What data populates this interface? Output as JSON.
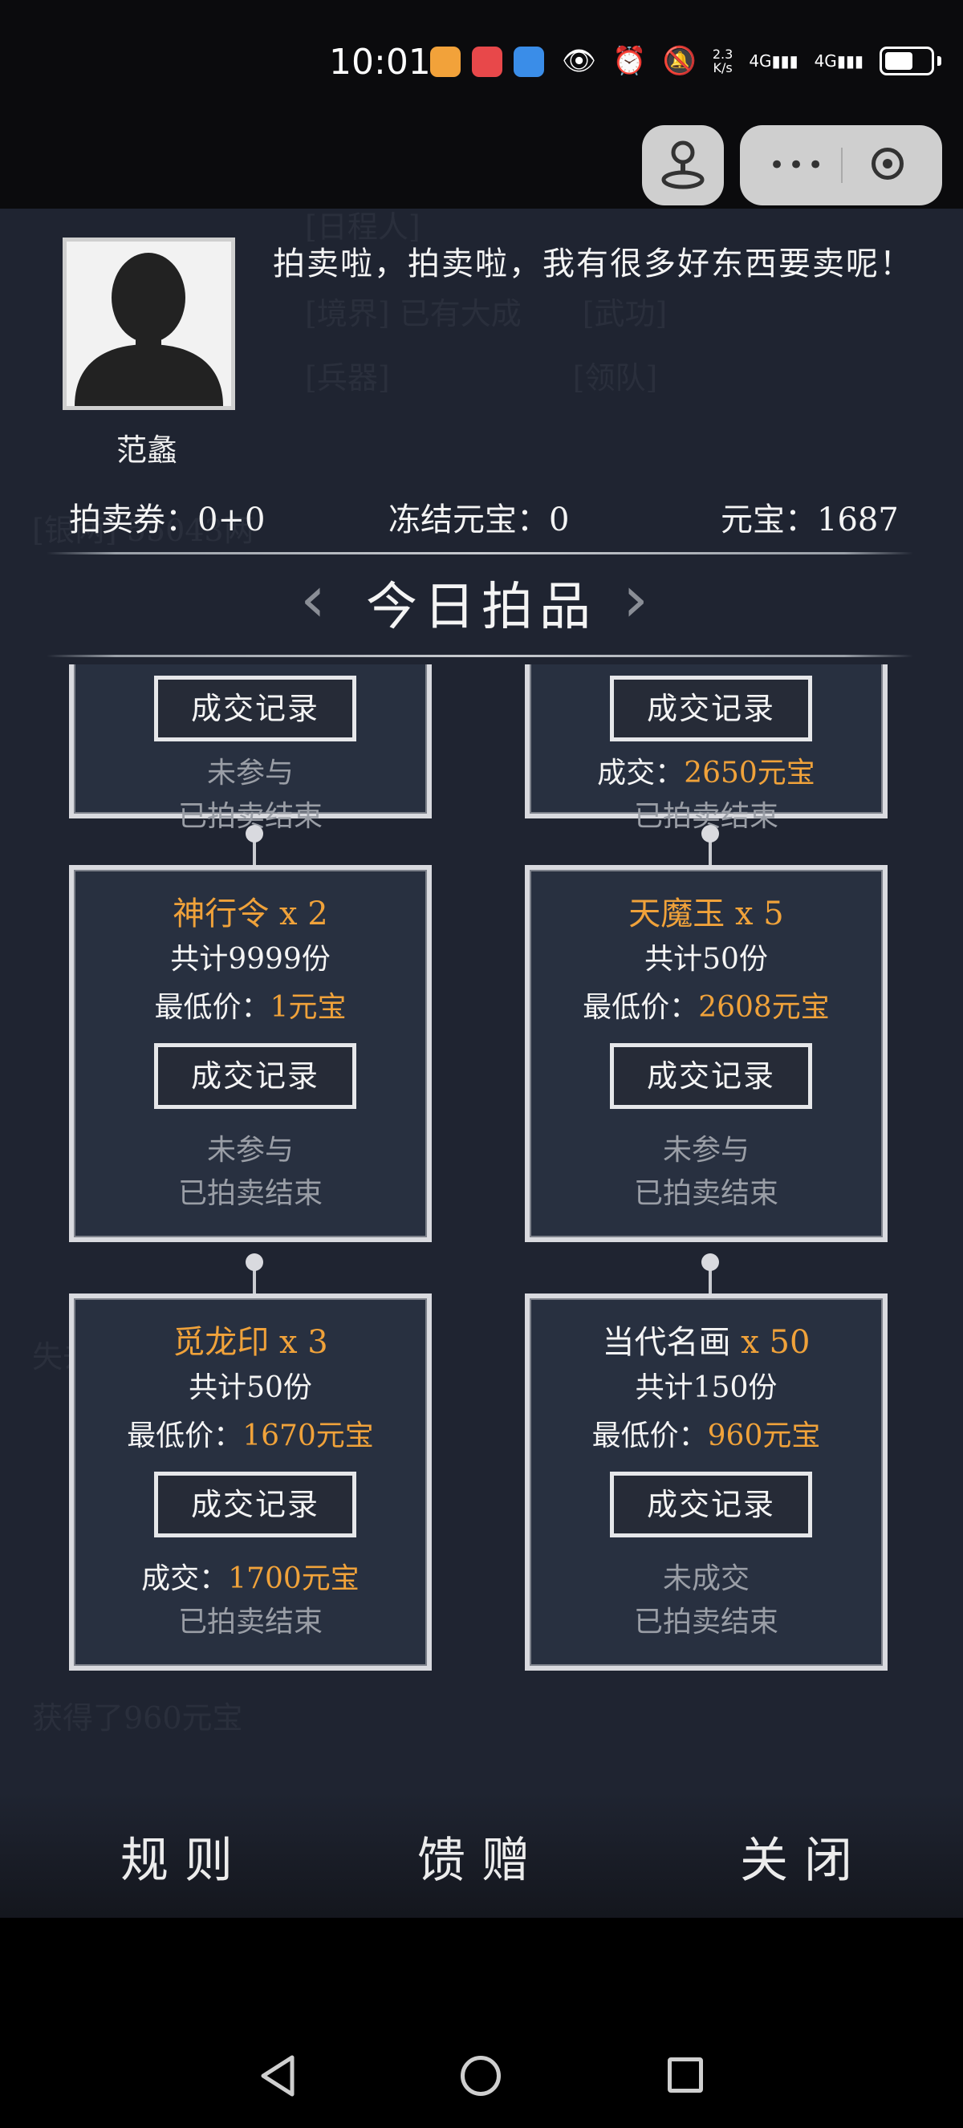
{
  "status_bar": {
    "time": "10:01",
    "net_speed_top": "2.3",
    "net_speed_bottom": "K/s",
    "sig1": "4G",
    "sig2": "4G"
  },
  "npc": {
    "name": "范蠡",
    "dialog": "拍卖啦，拍卖啦，我有很多好东西要卖呢！"
  },
  "stats": {
    "ticket": "拍卖券：0+0",
    "frozen": "冻结元宝：0",
    "yuanbao": "元宝：1687"
  },
  "section_title": "今日拍品",
  "record_label": "成交记录",
  "cards": [
    {
      "status1": "未参与",
      "status2": "已拍卖结束"
    },
    {
      "status1_prefix": "成交：",
      "status1_value": "2650元宝",
      "status2": "已拍卖结束"
    },
    {
      "name": "神行令",
      "qty": " x 2",
      "total": "共计9999份",
      "min_label": "最低价：",
      "min_value": "1元宝",
      "status1": "未参与",
      "status2": "已拍卖结束"
    },
    {
      "name": "天魔玉",
      "qty": " x 5",
      "total": "共计50份",
      "min_label": "最低价：",
      "min_value": "2608元宝",
      "status1": "未参与",
      "status2": "已拍卖结束"
    },
    {
      "name": "觅龙印",
      "qty": " x 3",
      "total": "共计50份",
      "min_label": "最低价：",
      "min_value": "1670元宝",
      "status1_prefix": "成交：",
      "status1_value": "1700元宝",
      "status2": "已拍卖结束"
    },
    {
      "name": "当代名画",
      "qty": " x 50",
      "total": "共计150份",
      "min_label": "最低价：",
      "min_value": "960元宝",
      "status1": "未成交",
      "status2": "已拍卖结束"
    }
  ],
  "bottom": {
    "rules": "规则",
    "gift": "馈赠",
    "close": "关闭"
  },
  "colors": {
    "accent": "#f0a23a",
    "panel": "#1f2431",
    "card": "#283040"
  }
}
